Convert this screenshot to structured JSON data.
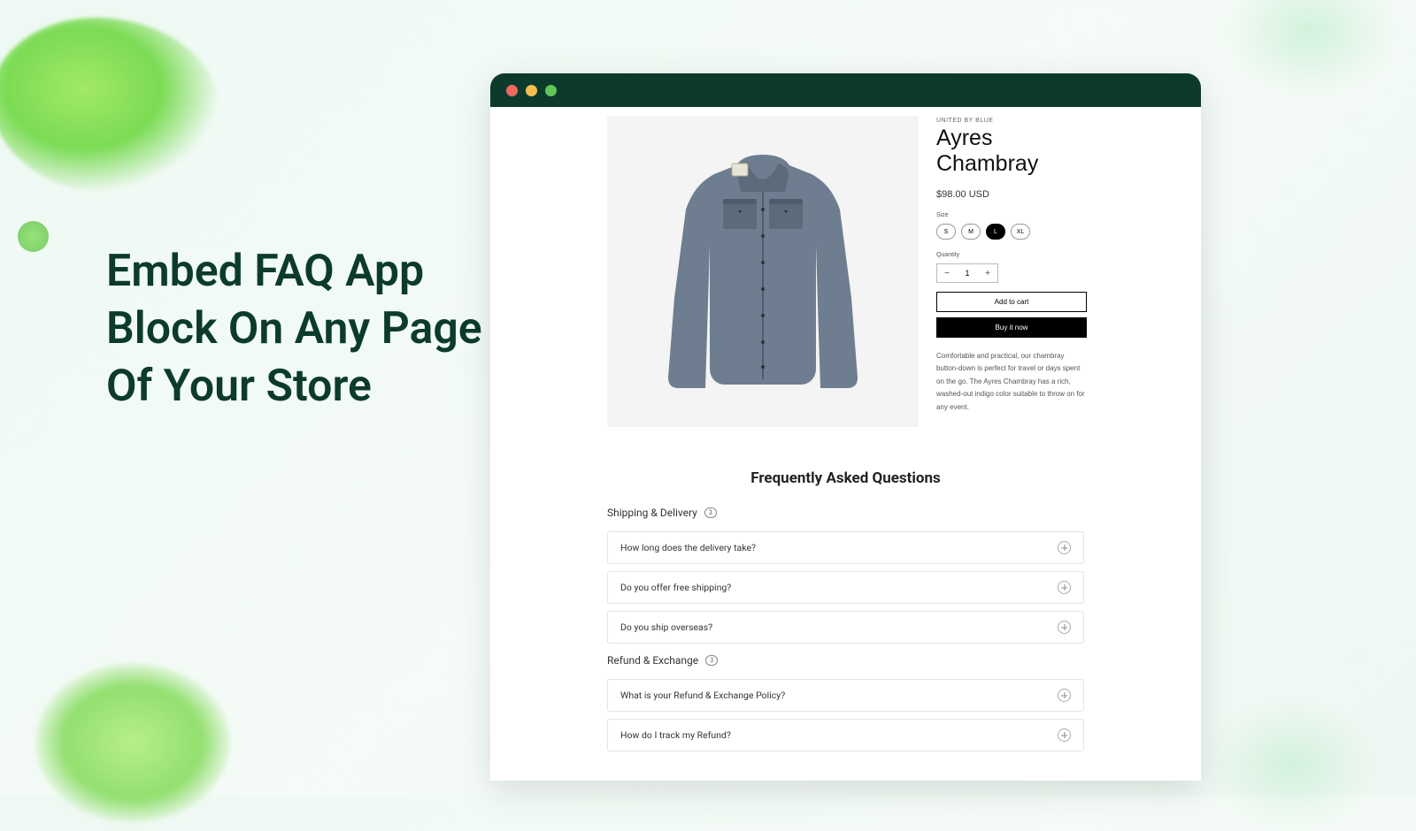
{
  "headline": {
    "line1": "Embed FAQ App",
    "line2": "Block On Any Page",
    "line3": "Of Your Store"
  },
  "product": {
    "vendor": "UNITED BY BLUE",
    "title": "Ayres Chambray",
    "price": "$98.00 USD",
    "size_label": "Size",
    "sizes": [
      "S",
      "M",
      "L",
      "XL"
    ],
    "selected_size": "L",
    "quantity_label": "Quantity",
    "quantity": "1",
    "add_to_cart": "Add to cart",
    "buy_now": "Buy it now",
    "description": "Comfortable and practical, our chambray button-down is perfect for travel or days spent on the go. The Ayres Chambray has a rich, washed-out indigo color suitable to throw on for any event."
  },
  "faq": {
    "title": "Frequently Asked Questions",
    "groups": [
      {
        "name": "Shipping & Delivery",
        "count": "3",
        "items": [
          "How long does the delivery take?",
          "Do you offer free shipping?",
          "Do you ship overseas?"
        ]
      },
      {
        "name": "Refund & Exchange",
        "count": "3",
        "items": [
          "What is your Refund & Exchange Policy?",
          "How do I track my Refund?"
        ]
      }
    ]
  }
}
